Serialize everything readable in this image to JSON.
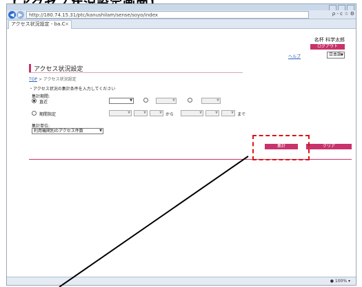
{
  "caption": "【アクセス状況設定画面】",
  "browser": {
    "url": "http://180.74.15.31/ptc/kanushilam/sense/soyo/index",
    "tab_title": "アクセス状況設定 - ba.C",
    "tab_close": "×",
    "toolbar_tools": "ρ - c  ☆ ⚙",
    "zoom": "● 100%  ▾"
  },
  "header": {
    "user_name": "名杯 科学太郎",
    "logout_label": "ログアウト",
    "help_label": "ヘルプ",
    "language": "日本語"
  },
  "page": {
    "title": "アクセス状況設定",
    "breadcrumb_home": "TOP",
    "breadcrumb_sep": ">",
    "breadcrumb_current": "アクセス状況設定",
    "instruction": "・アクセス状況の集計条件を入力してください"
  },
  "form": {
    "period_label": "集計期間:",
    "radio_recent_label": "直近",
    "radio_period_label": "期間指定",
    "from_label": "から",
    "to_label": "まで",
    "unit_label": "集計単位:",
    "unit_value": "利用機関別のアクセス件数"
  },
  "buttons": {
    "submit_label": "集計",
    "clear_label": "クリア"
  },
  "colors": {
    "accent": "#c7336a",
    "annotation": "#e01010"
  }
}
